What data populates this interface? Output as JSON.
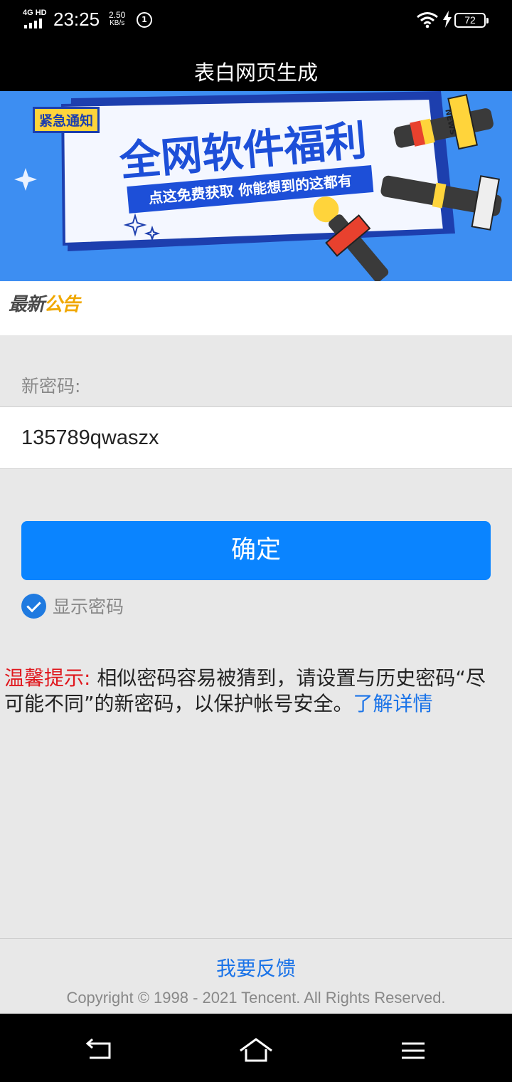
{
  "status_bar": {
    "network": "4G HD",
    "time": "23:25",
    "speed_value": "2.50",
    "speed_unit": "KB/s",
    "circle_badge": "1",
    "battery": "72"
  },
  "header": {
    "title": "表白网页生成"
  },
  "banner": {
    "tag": "紧急通知",
    "headline": "全网软件福利",
    "subline": "点这免费获取 你能想到的这都有",
    "mic_label": "NEWS"
  },
  "notice": {
    "logo_part1": "最新",
    "logo_part2": "公告"
  },
  "form": {
    "label": "新密码:",
    "value": "135789qwaszx",
    "confirm_label": "确定",
    "show_password_label": "显示密码",
    "show_password_checked": true
  },
  "tip": {
    "label": "温馨提示:",
    "text": "  相似密码容易被猜到，请设置与历史密码“尽可能不同”的新密码，以保护帐号安全。",
    "link": "了解详情"
  },
  "footer": {
    "feedback": "我要反馈",
    "copyright": "Copyright © 1998 - 2021 Tencent. All Rights Reserved."
  },
  "colors": {
    "accent": "#0a84ff",
    "link": "#1a73e8",
    "warning": "#e0181e",
    "banner_bg": "#3d8ef2",
    "logo_gold": "#f0a800"
  }
}
